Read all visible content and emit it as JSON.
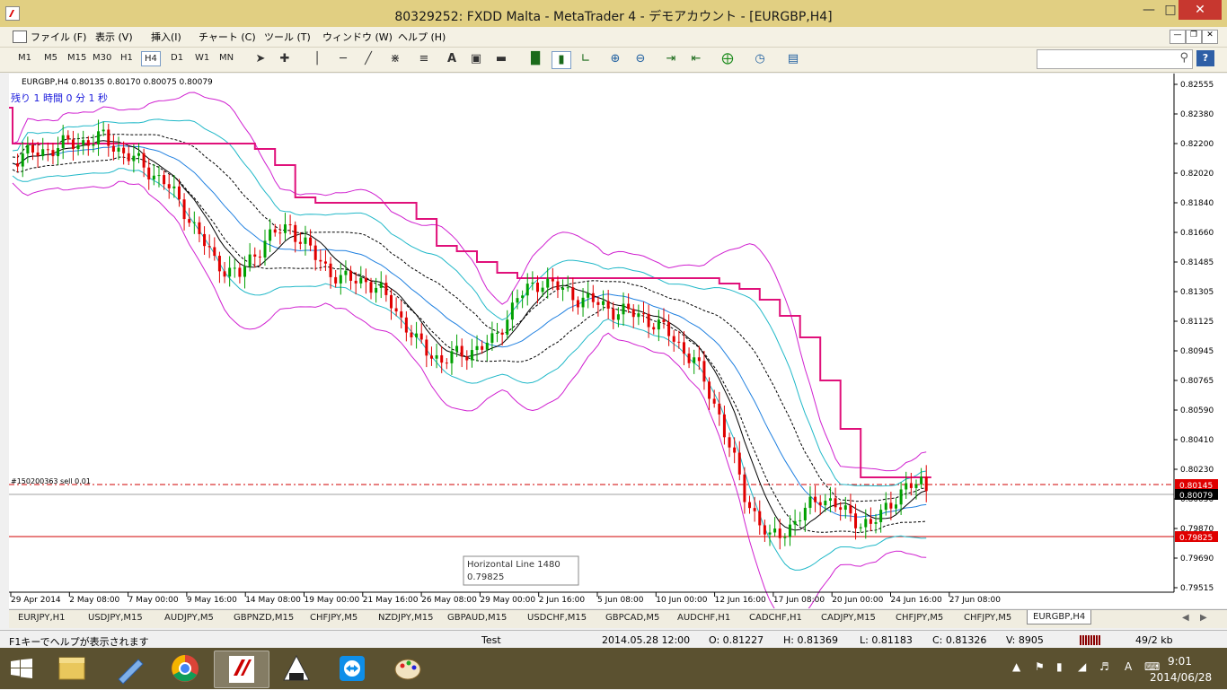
{
  "window": {
    "title": "80329252: FXDD Malta - MetaTrader 4 - デモアカウント - [EURGBP,H4]"
  },
  "menu": [
    "ファイル (F)",
    "表示 (V)",
    "挿入(I)",
    "チャート (C)",
    "ツール (T)",
    "ウィンドウ (W)",
    "ヘルプ (H)"
  ],
  "timeframes": [
    "M1",
    "M5",
    "M15",
    "M30",
    "H1",
    "H4",
    "D1",
    "W1",
    "MN"
  ],
  "active_timeframe": "H4",
  "chart": {
    "symbol_info": "EURGBP,H4  0.80135 0.80170 0.80075 0.80079",
    "countdown": "残り 1 時間 0 分 1 秒",
    "order_label": "#150200363 sell 0.01",
    "tooltip_title": "Horizontal Line 1480",
    "tooltip_value": "0.79825",
    "price_order": "0.80145",
    "price_current": "0.80079",
    "price_hline": "0.79825",
    "price_axis": [
      "0.82555",
      "0.82380",
      "0.82200",
      "0.82020",
      "0.81840",
      "0.81660",
      "0.81485",
      "0.81305",
      "0.81125",
      "0.80945",
      "0.80765",
      "0.80590",
      "0.80410",
      "0.80230",
      "0.80050",
      "0.79870",
      "0.79690",
      "0.79515"
    ],
    "time_axis": [
      "29 Apr 2014",
      "2 May 08:00",
      "7 May 00:00",
      "9 May 16:00",
      "14 May 08:00",
      "19 May 00:00",
      "21 May 16:00",
      "26 May 08:00",
      "29 May 00:00",
      "2 Jun 16:00",
      "5 Jun 08:00",
      "10 Jun 00:00",
      "12 Jun 16:00",
      "17 Jun 08:00",
      "20 Jun 00:00",
      "24 Jun 16:00",
      "27 Jun 08:00"
    ],
    "colors": {
      "up": "#00a000",
      "down": "#e00000",
      "magenta": "#d020d0",
      "cyan": "#20b8c8",
      "blue": "#2080e0",
      "trail": "#e0107a"
    }
  },
  "tabs": [
    "EURJPY,H1",
    "USDJPY,M15",
    "AUDJPY,M5",
    "GBPNZD,M15",
    "CHFJPY,M5",
    "NZDJPY,M15",
    "GBPAUD,M15",
    "USDCHF,M15",
    "GBPCAD,M5",
    "AUDCHF,H1",
    "CADCHF,H1",
    "CADJPY,M15",
    "CHFJPY,M5",
    "CHFJPY,M5",
    "EURGBP,H4"
  ],
  "active_tab": "EURGBP,H4",
  "status": {
    "help": "F1キーでヘルプが表示されます",
    "profile": "Test",
    "datetime": "2014.05.28 12:00",
    "open": "O: 0.81227",
    "high": "H: 0.81369",
    "low": "L: 0.81183",
    "close": "C: 0.81326",
    "volume": "V: 8905",
    "traffic": "49/2 kb"
  },
  "taskbar": {
    "time": "9:01",
    "date": "2014/06/28",
    "ime": "A"
  }
}
